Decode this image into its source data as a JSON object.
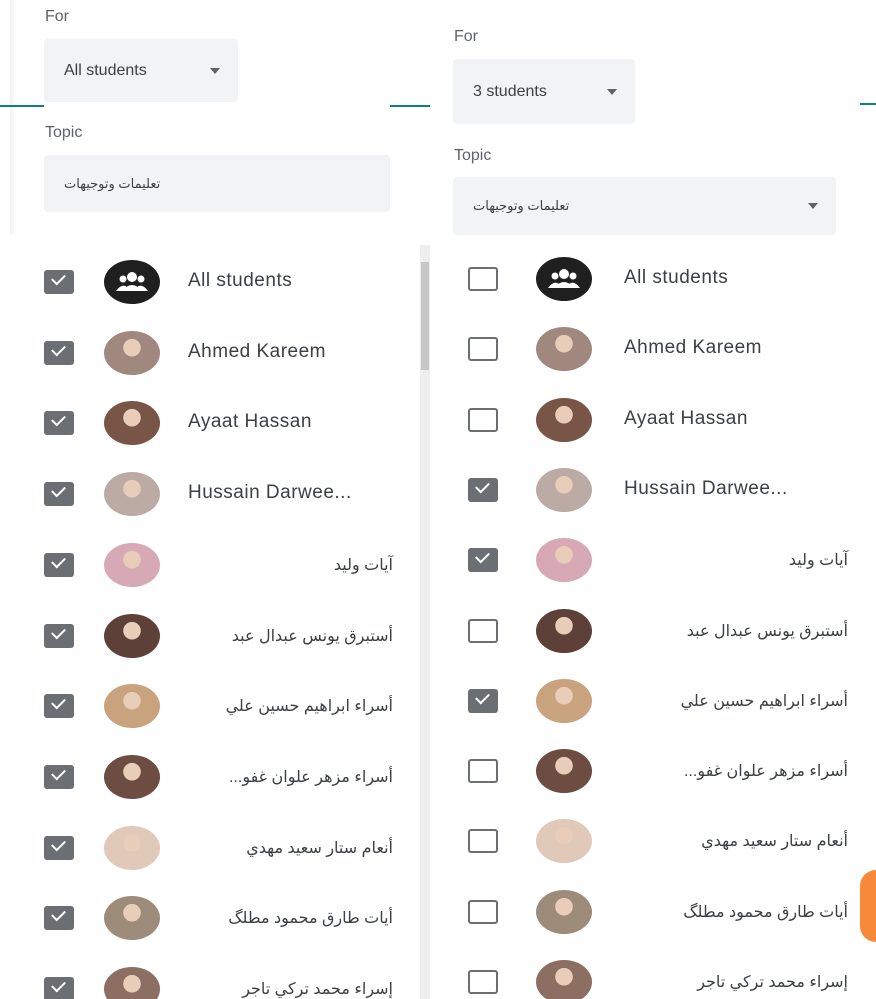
{
  "colors": {
    "accent_line": "#0f7f86",
    "checkbox": "#6b6f73",
    "select_bg": "#f1f3f4",
    "orange_tab": "#f7893b"
  },
  "left": {
    "for_label": "For",
    "for_value": "All students",
    "topic_label": "Topic",
    "topic_value": "تعليمات وتوجيهات",
    "students": [
      {
        "name": "All students",
        "checked": true,
        "avatar": "group-icon"
      },
      {
        "name": "Ahmed Kareem",
        "checked": true,
        "avatar": "photo"
      },
      {
        "name": "Ayaat Hassan",
        "checked": true,
        "avatar": "photo"
      },
      {
        "name": "Hussain Darwee...",
        "checked": true,
        "avatar": "photo"
      },
      {
        "name": "آيات وليد",
        "checked": true,
        "avatar": "photo"
      },
      {
        "name": "أستبرق يونس عبدال عبد",
        "checked": true,
        "avatar": "photo"
      },
      {
        "name": "أسراء ابراهيم حسين علي",
        "checked": true,
        "avatar": "photo"
      },
      {
        "name": "أسراء مزهر علوان غفو...",
        "checked": true,
        "avatar": "photo"
      },
      {
        "name": "أنعام ستار سعيد مهدي",
        "checked": true,
        "avatar": "photo"
      },
      {
        "name": "أيات طارق محمود مطلگ",
        "checked": true,
        "avatar": "photo"
      },
      {
        "name": "إسراء محمد تركي تاجر",
        "checked": true,
        "avatar": "photo"
      }
    ]
  },
  "right": {
    "for_label": "For",
    "for_value": "3 students",
    "topic_label": "Topic",
    "topic_value": "تعليمات وتوجيهات",
    "students": [
      {
        "name": "All students",
        "checked": false,
        "avatar": "group-icon"
      },
      {
        "name": "Ahmed Kareem",
        "checked": false,
        "avatar": "photo"
      },
      {
        "name": "Ayaat Hassan",
        "checked": false,
        "avatar": "photo"
      },
      {
        "name": "Hussain Darwee...",
        "checked": true,
        "avatar": "photo"
      },
      {
        "name": "آيات وليد",
        "checked": true,
        "avatar": "photo"
      },
      {
        "name": "أستبرق يونس عبدال عبد",
        "checked": false,
        "avatar": "photo"
      },
      {
        "name": "أسراء ابراهيم حسين علي",
        "checked": true,
        "avatar": "photo"
      },
      {
        "name": "أسراء مزهر علوان غفو...",
        "checked": false,
        "avatar": "photo"
      },
      {
        "name": "أنعام ستار سعيد مهدي",
        "checked": false,
        "avatar": "photo"
      },
      {
        "name": "أيات طارق محمود مطلگ",
        "checked": false,
        "avatar": "photo"
      },
      {
        "name": "إسراء محمد تركي تاجر",
        "checked": false,
        "avatar": "photo"
      }
    ]
  }
}
